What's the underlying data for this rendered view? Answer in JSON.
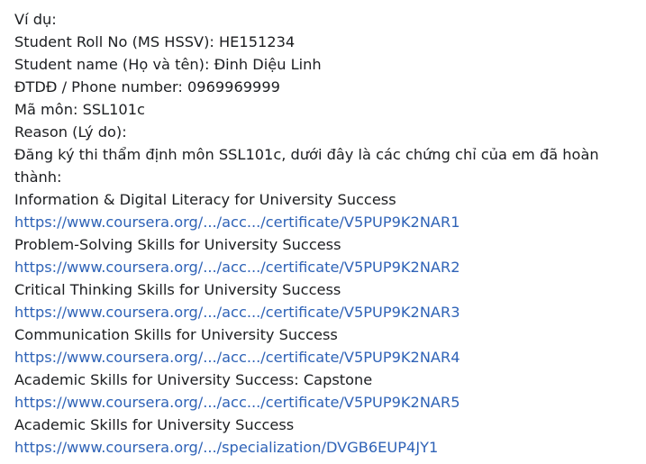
{
  "message": {
    "example_label": "Ví dụ:",
    "roll_no": "Student Roll No (MS HSSV): HE151234",
    "student_name": "Student name (Họ và tên): Đinh Diệu Linh",
    "phone": "ĐTDĐ / Phone number: 0969969999",
    "course_code": "Mã môn: SSL101c",
    "reason_label": "Reason (Lý do):",
    "reason_text": " Đăng ký thi thẩm định môn SSL101c, dưới đây là các chứng chỉ của em đã hoàn thành:",
    "certificates": [
      {
        "title": "Information & Digital Literacy for University Success",
        "url": "https://www.coursera.org/.../acc.../certificate/V5PUP9K2NAR1"
      },
      {
        "title": "Problem-Solving Skills for University Success",
        "url": "https://www.coursera.org/.../acc.../certificate/V5PUP9K2NAR2"
      },
      {
        "title": "Critical Thinking Skills for University Success",
        "url": "https://www.coursera.org/.../acc.../certificate/V5PUP9K2NAR3"
      },
      {
        "title": "Communication Skills for University Success",
        "url": "https://www.coursera.org/.../acc.../certificate/V5PUP9K2NAR4"
      },
      {
        "title": "Academic Skills for University Success: Capstone",
        "url": "https://www.coursera.org/.../acc.../certificate/V5PUP9K2NAR5"
      },
      {
        "title": "Academic Skills for University Success",
        "url": "https://www.coursera.org/.../specialization/DVGB6EUP4JY1"
      }
    ]
  },
  "colors": {
    "text": "#1c1e21",
    "link": "#2f63b7",
    "background": "#ffffff"
  }
}
